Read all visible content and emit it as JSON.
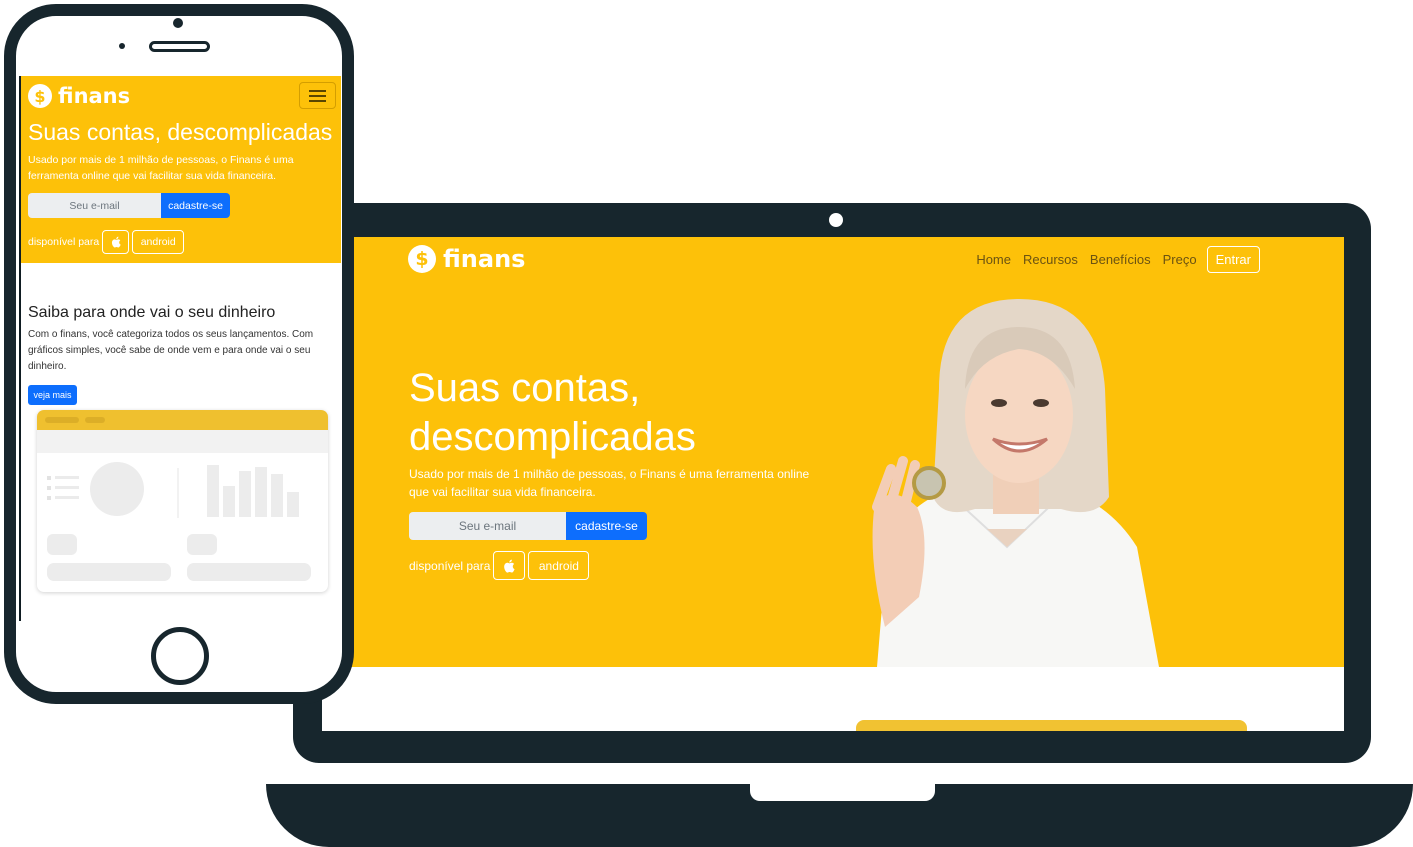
{
  "colors": {
    "brand_yellow": "#fdc109",
    "device_frame": "#17262d",
    "primary_blue": "#0d6efd",
    "white": "#ffffff"
  },
  "icons": {
    "logo": "dollar-coin-icon",
    "apple": "apple-icon",
    "menu": "hamburger-menu-icon"
  },
  "brand": {
    "coin_symbol": "$",
    "name": "finans"
  },
  "laptop": {
    "nav": {
      "items": [
        "Home",
        "Recursos",
        "Benefícios",
        "Preço"
      ],
      "login_label": "Entrar"
    },
    "hero": {
      "title_line1": "Suas contas,",
      "title_line2": "descomplicadas",
      "subtitle": "Usado por mais de 1 milhão de pessoas, o Finans é uma ferramenta online que vai facilitar sua vida financeira.",
      "email_placeholder": "Seu e-mail",
      "signup_label": "cadastre-se",
      "available_label": "disponível para",
      "android_label": "android"
    }
  },
  "phone": {
    "hero": {
      "title": "Suas contas, descomplicadas",
      "subtitle": "Usado por mais de 1 milhão de pessoas, o Finans é uma ferramenta online que vai facilitar sua vida financeira.",
      "email_placeholder": "Seu e-mail",
      "signup_label": "cadastre-se",
      "available_label": "disponível para",
      "android_label": "android"
    },
    "section": {
      "title": "Saiba para onde vai o seu dinheiro",
      "text": "Com o finans, você categoriza todos os seus lançamentos. Com gráficos simples, você sabe de onde vem e para onde vai o seu dinheiro.",
      "button_label": "veja mais"
    }
  }
}
